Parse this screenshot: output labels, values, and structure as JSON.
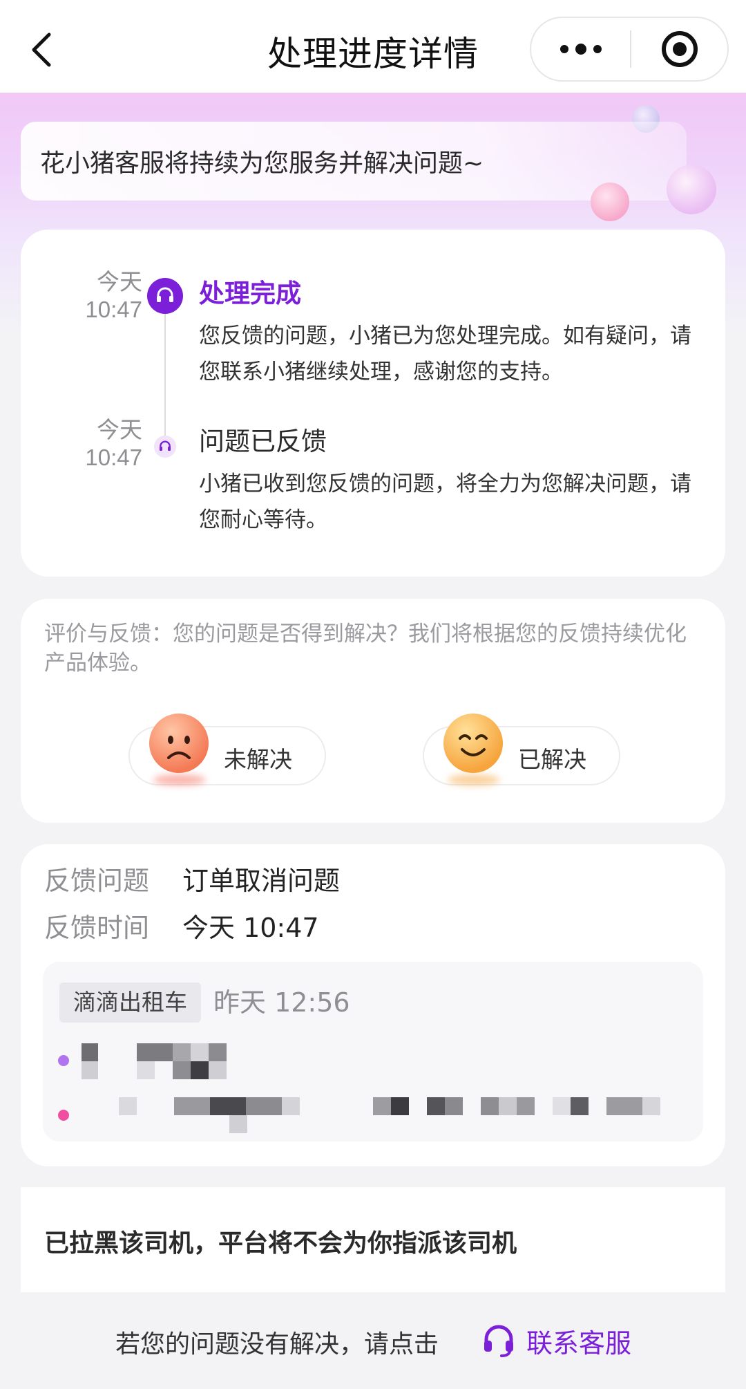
{
  "navbar": {
    "title": "处理进度详情",
    "back_icon": "chevron-left-icon",
    "more_icon": "more-dots-icon",
    "close_icon": "target-close-icon"
  },
  "banner": {
    "notice": "花小猪客服将持续为您服务并解决问题~"
  },
  "timeline": [
    {
      "day": "今天",
      "time": "10:47",
      "title": "处理完成",
      "desc": "您反馈的问题，小猪已为您处理完成。如有疑问，请您联系小猪继续处理，感谢您的支持。",
      "status": "active",
      "icon": "headset-icon"
    },
    {
      "day": "今天",
      "time": "10:47",
      "title": "问题已反馈",
      "desc": "小猪已收到您反馈的问题，将全力为您解决问题，请您耐心等待。",
      "status": "inactive",
      "icon": "headset-icon"
    }
  ],
  "feedback": {
    "prompt": "评价与反馈：您的问题是否得到解决？我们将根据您的反馈持续优化产品体验。",
    "unsolved_label": "未解决",
    "solved_label": "已解决"
  },
  "info": {
    "issue_key": "反馈问题",
    "issue_value": "订单取消问题",
    "time_key": "反馈时间",
    "time_value": "今天 10:47",
    "order": {
      "service_tag": "滴滴出租车",
      "order_time": "昨天 12:56"
    }
  },
  "blacklist_notice": "已拉黑该司机，平台将不会为你指派该司机",
  "footer": {
    "hint": "若您的问题没有解决，请点击",
    "contact_label": "联系客服",
    "contact_icon": "headset-icon"
  },
  "colors": {
    "accent": "#7b1fd8",
    "start_dot": "#b074ee",
    "end_dot": "#f04ea0"
  }
}
